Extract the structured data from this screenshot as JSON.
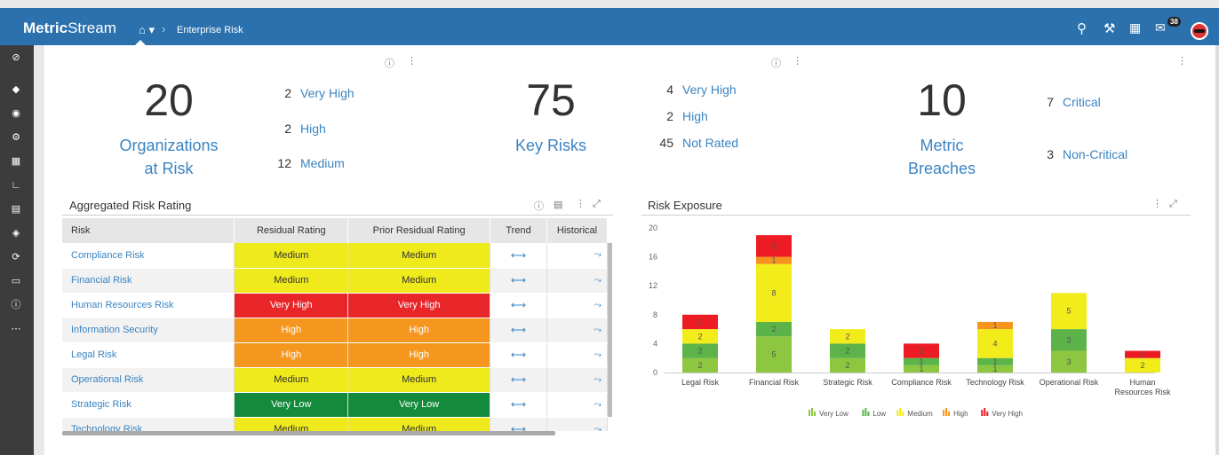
{
  "header": {
    "brand_bold": "Metric",
    "brand_rest": "Stream",
    "breadcrumb": "Enterprise Risk",
    "notification_count": "38",
    "icons": [
      "search-icon",
      "tools-icon",
      "calendar-icon",
      "messages-icon",
      "avatar"
    ]
  },
  "sidebar": {
    "icons": [
      "disabled-icon",
      "home-icon",
      "target-icon",
      "gear-icon",
      "grid-icon",
      "chart-icon",
      "document-icon",
      "shield-icon",
      "refresh-icon",
      "box-icon",
      "help-icon",
      "more-icon"
    ]
  },
  "kpi": {
    "org": {
      "number": "20",
      "label1": "Organizations",
      "label2": "at Risk",
      "items": [
        {
          "n": "2",
          "l": "Very High"
        },
        {
          "n": "2",
          "l": "High"
        },
        {
          "n": "12",
          "l": "Medium"
        }
      ]
    },
    "risks": {
      "number": "75",
      "label": "Key Risks",
      "items": [
        {
          "n": "4",
          "l": "Very High"
        },
        {
          "n": "2",
          "l": "High"
        },
        {
          "n": "45",
          "l": "Not Rated"
        }
      ]
    },
    "metric": {
      "number": "10",
      "label1": "Metric",
      "label2": "Breaches",
      "items": [
        {
          "n": "7",
          "l": "Critical"
        },
        {
          "n": "3",
          "l": "Non-Critical"
        }
      ]
    }
  },
  "aggregated": {
    "title": "Aggregated Risk Rating",
    "columns": [
      "Risk",
      "Residual Rating",
      "Prior Residual Rating",
      "Trend",
      "Historical"
    ],
    "rows": [
      {
        "risk": "Compliance Risk",
        "residual": "Medium",
        "prior": "Medium",
        "trend": "⟷"
      },
      {
        "risk": "Financial Risk",
        "residual": "Medium",
        "prior": "Medium",
        "trend": "⟷"
      },
      {
        "risk": "Human Resources Risk",
        "residual": "Very High",
        "prior": "Very High",
        "trend": "⟷"
      },
      {
        "risk": "Information Security",
        "residual": "High",
        "prior": "High",
        "trend": "⟷"
      },
      {
        "risk": "Legal Risk",
        "residual": "High",
        "prior": "High",
        "trend": "⟷"
      },
      {
        "risk": "Operational Risk",
        "residual": "Medium",
        "prior": "Medium",
        "trend": "⟷"
      },
      {
        "risk": "Strategic Risk",
        "residual": "Very Low",
        "prior": "Very Low",
        "trend": "⟷"
      },
      {
        "risk": "Technology Risk",
        "residual": "Medium",
        "prior": "Medium",
        "trend": "⟷"
      }
    ],
    "rating_colors": {
      "Very Low": "#138a3c",
      "Low": "#5fb548",
      "Medium": "#eeea1c",
      "High": "#f5961e",
      "Very High": "#e8262a"
    }
  },
  "exposure": {
    "title": "Risk Exposure"
  },
  "chart_data": {
    "type": "bar",
    "stacked": true,
    "categories": [
      "Legal Risk",
      "Financial Risk",
      "Strategic Risk",
      "Compliance Risk",
      "Technology Risk",
      "Operational Risk",
      "Human Resources Risk"
    ],
    "category_lines": [
      [
        "Legal Risk"
      ],
      [
        "Financial Risk"
      ],
      [
        "Strategic Risk"
      ],
      [
        "Compliance Risk"
      ],
      [
        "Technology Risk"
      ],
      [
        "Operational Risk"
      ],
      [
        "Human",
        "Resources Risk"
      ]
    ],
    "series": [
      {
        "name": "Very Low",
        "color": "#8dc63f",
        "values": [
          2,
          5,
          2,
          1,
          1,
          3,
          0
        ]
      },
      {
        "name": "Low",
        "color": "#5bb349",
        "values": [
          2,
          2,
          2,
          1,
          1,
          3,
          0
        ]
      },
      {
        "name": "Medium",
        "color": "#f2ec1b",
        "values": [
          2,
          8,
          2,
          0,
          4,
          5,
          2
        ]
      },
      {
        "name": "High",
        "color": "#f7941d",
        "values": [
          0,
          1,
          0,
          0,
          1,
          0,
          0
        ]
      },
      {
        "name": "Very High",
        "color": "#ed1c24",
        "values": [
          2,
          3,
          0,
          2,
          0,
          0,
          1
        ]
      }
    ],
    "ylim": [
      0,
      20
    ],
    "yticks": [
      0,
      4,
      8,
      12,
      16,
      20
    ],
    "legend_position": "bottom",
    "grid": false
  }
}
